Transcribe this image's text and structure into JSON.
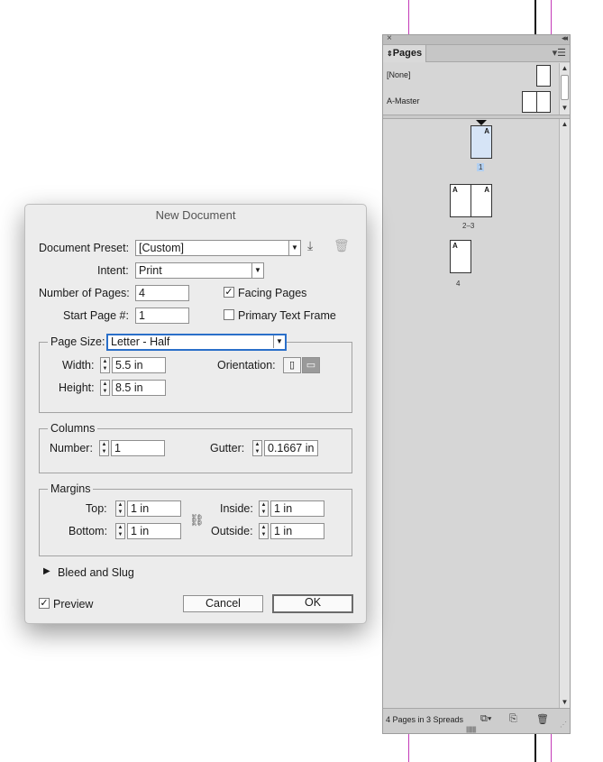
{
  "pages_panel": {
    "tab_label": "Pages",
    "masters": [
      {
        "label": "[None]"
      },
      {
        "label": "A-Master"
      }
    ],
    "page_markers": {
      "page1": "A",
      "spread2_left": "A",
      "spread2_right": "A",
      "page4": "A"
    },
    "page_numbers": [
      "1",
      "2–3",
      "4"
    ],
    "footer_status": "4 Pages in 3 Spreads"
  },
  "dialog": {
    "title": "New Document",
    "preset_label": "Document Preset:",
    "preset_value": "[Custom]",
    "intent_label": "Intent:",
    "intent_value": "Print",
    "num_pages_label": "Number of Pages:",
    "num_pages_value": "4",
    "start_page_label": "Start Page #:",
    "start_page_value": "1",
    "facing_pages_label": "Facing Pages",
    "facing_pages_checked": true,
    "primary_text_frame_label": "Primary Text Frame",
    "primary_text_frame_checked": false,
    "page_size_label": "Page Size:",
    "page_size_value": "Letter - Half",
    "width_label": "Width:",
    "width_value": "5.5 in",
    "height_label": "Height:",
    "height_value": "8.5 in",
    "orientation_label": "Orientation:",
    "columns_title": "Columns",
    "number_label": "Number:",
    "number_value": "1",
    "gutter_label": "Gutter:",
    "gutter_value": "0.1667 in",
    "margins_title": "Margins",
    "top_label": "Top:",
    "top_value": "1 in",
    "bottom_label": "Bottom:",
    "bottom_value": "1 in",
    "inside_label": "Inside:",
    "inside_value": "1 in",
    "outside_label": "Outside:",
    "outside_value": "1 in",
    "bleed_label": "Bleed and Slug",
    "preview_label": "Preview",
    "preview_checked": true,
    "cancel_label": "Cancel",
    "ok_label": "OK"
  },
  "colors": {
    "guide": "#c43ab8",
    "focus": "#2a6fc9",
    "selection": "#b2cff0"
  }
}
